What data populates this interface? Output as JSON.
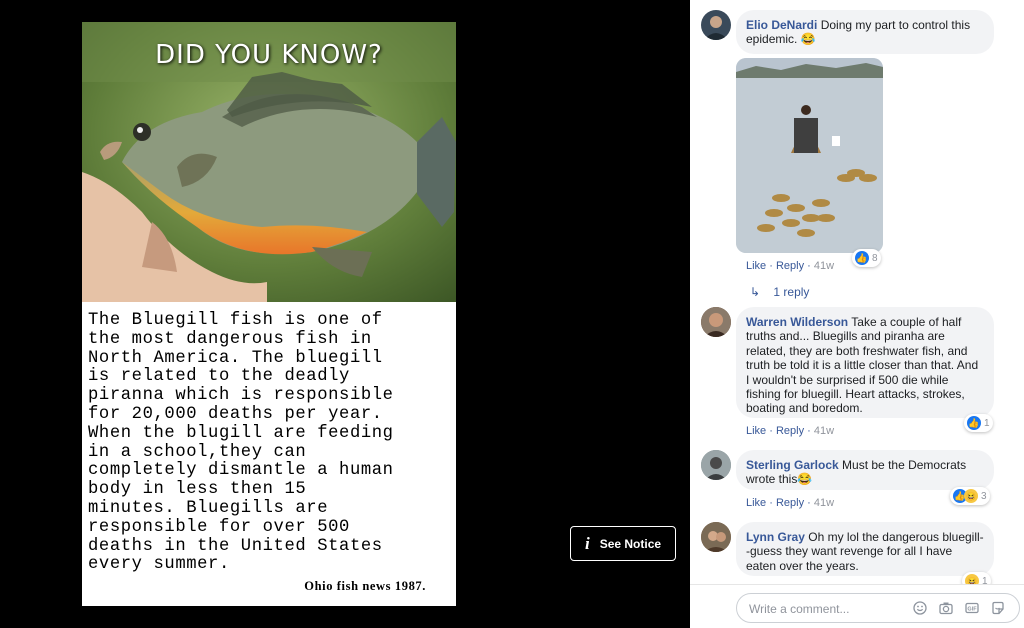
{
  "post": {
    "headline": "DID YOU KNOW?",
    "caption": "The Bluegill fish is one of\nthe most dangerous fish in\nNorth America. The bluegill\nis related to the deadly\npiranna which is responsible\nfor 20,000 deaths per year.\nWhen the blugill are feeding\nin a school,they can\ncompletely dismantle a human\nbody in less then 15\nminutes. Bluegills are\nresponsible for over 500\ndeaths in the United States\nevery summer.",
    "credit": "Ohio fish news 1987."
  },
  "notice": {
    "label": "See Notice",
    "icon": "info-icon"
  },
  "comments": [
    {
      "name": "Elio DeNardi",
      "text": "Doing my part to control this epidemic. 😂",
      "like": "Like",
      "reply": "Reply",
      "time": "41w",
      "reactions": "8"
    },
    {
      "name": "Warren Wilderson",
      "text": "Take a couple of half truths and... Bluegills and piranha are related, they are both freshwater fish, and truth be told it is a little closer than that. And I wouldn't be surprised if 500 die while fishing for bluegill. Heart attacks, strokes, boating and boredom.",
      "like": "Like",
      "reply": "Reply",
      "time": "41w",
      "reactions": "1"
    },
    {
      "name": "Sterling Garlock",
      "text": "Must be the Democrats wrote this😂",
      "like": "Like",
      "reply": "Reply",
      "time": "41w",
      "reactions": "3"
    },
    {
      "name": "Lynn Gray",
      "text": "Oh my lol the dangerous bluegill--guess they want revenge for all I have eaten over the years.",
      "reactions": "1"
    }
  ],
  "replies": {
    "label": "1 reply"
  },
  "composer": {
    "placeholder": "Write a comment..."
  },
  "colors": {
    "link": "#385898",
    "like_blue": "#1877f2",
    "bubble": "#f2f3f5"
  }
}
